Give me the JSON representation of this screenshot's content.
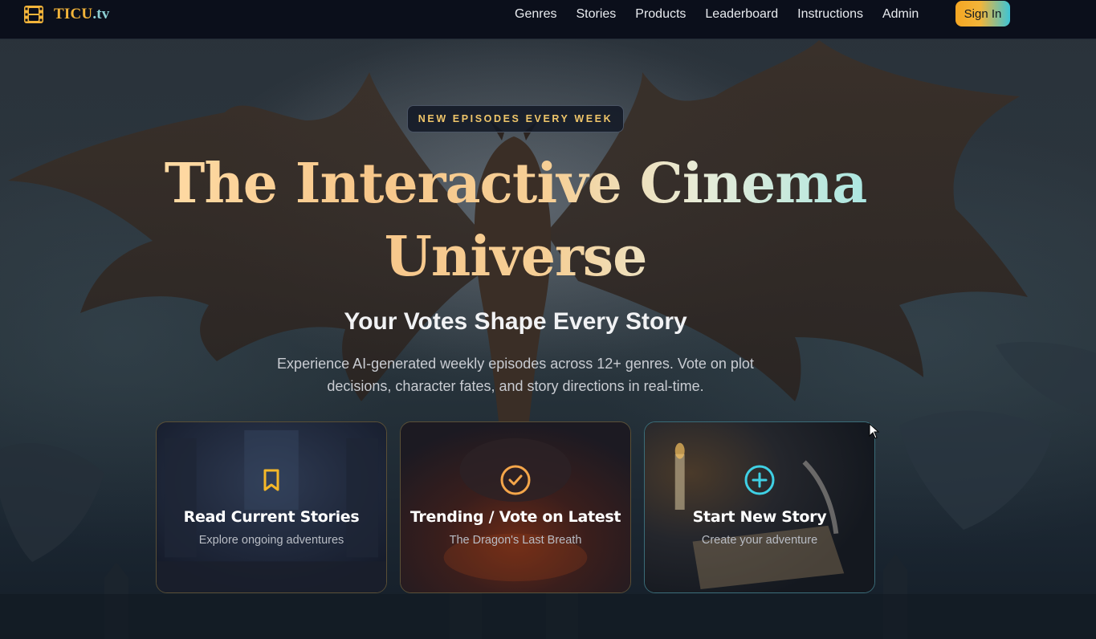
{
  "nav": {
    "brand_name": "TICU",
    "brand_tld": ".tv",
    "links": [
      "Genres",
      "Stories",
      "Products",
      "Leaderboard",
      "Instructions",
      "Admin"
    ],
    "signin_label": "Sign In"
  },
  "hero": {
    "badge": "NEW EPISODES EVERY WEEK",
    "title_line1": "The Interactive Cinema",
    "title_line2": "Universe",
    "subtitle": "Your Votes Shape Every Story",
    "description": "Experience AI-generated weekly episodes across 12+ genres. Vote on plot decisions, character fates, and story directions in real-time."
  },
  "cards": [
    {
      "icon": "bookmark-icon",
      "title": "Read Current Stories",
      "subtitle": "Explore ongoing adventures",
      "accent": "#f5b829"
    },
    {
      "icon": "check-circle-icon",
      "title": "Trending / Vote on Latest",
      "subtitle": "The Dragon's Last Breath",
      "accent": "#f5a64a"
    },
    {
      "icon": "plus-circle-icon",
      "title": "Start New Story",
      "subtitle": "Create your adventure",
      "accent": "#3fd0e4"
    }
  ],
  "colors": {
    "brand": "#f3b43a",
    "nav_bg": "#0a0e1a",
    "badge_text": "#f0c66a"
  }
}
